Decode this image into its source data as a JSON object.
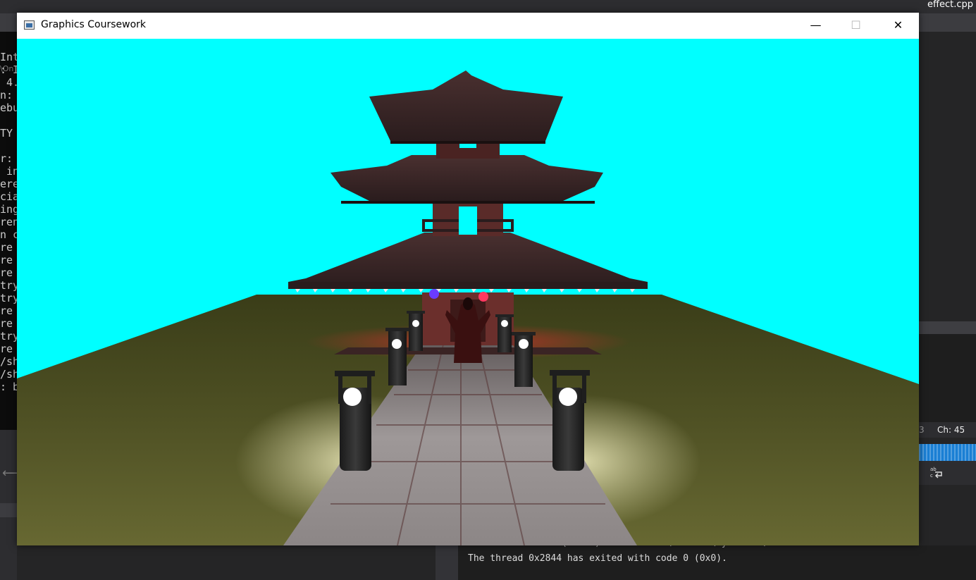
{
  "ide": {
    "open_tab": "effect.cpp",
    "console_path": "\\On",
    "console_lines": [
      "Int",
      ": I",
      " 4.",
      "n:",
      "ebu",
      "",
      "TY",
      "",
      "r:",
      " in",
      "ere",
      "cia",
      "ing",
      "ren",
      "n c",
      "re",
      "re",
      "re",
      "try",
      "try",
      "re",
      "re",
      "try",
      "re",
      "/sh",
      "/sh",
      ": b"
    ],
    "status": {
      "line_fragment": "3",
      "column": "Ch: 45"
    },
    "output_lines": [
      "'coursework.exe' (Win32): Loaded 'C:\\Windows\\System32\\dcdbutil'.",
      "The thread 0x2844 has exited with code 0 (0x0)."
    ],
    "wrap_icon": "word-wrap-icon",
    "back_icon": "arrow-left-icon"
  },
  "window": {
    "title": "Graphics Coursework",
    "minimize_symbol": "—",
    "maximize_symbol": "☐",
    "close_symbol": "✕",
    "sky_color": "#00ffff",
    "scene": "pagoda-temple-render"
  }
}
